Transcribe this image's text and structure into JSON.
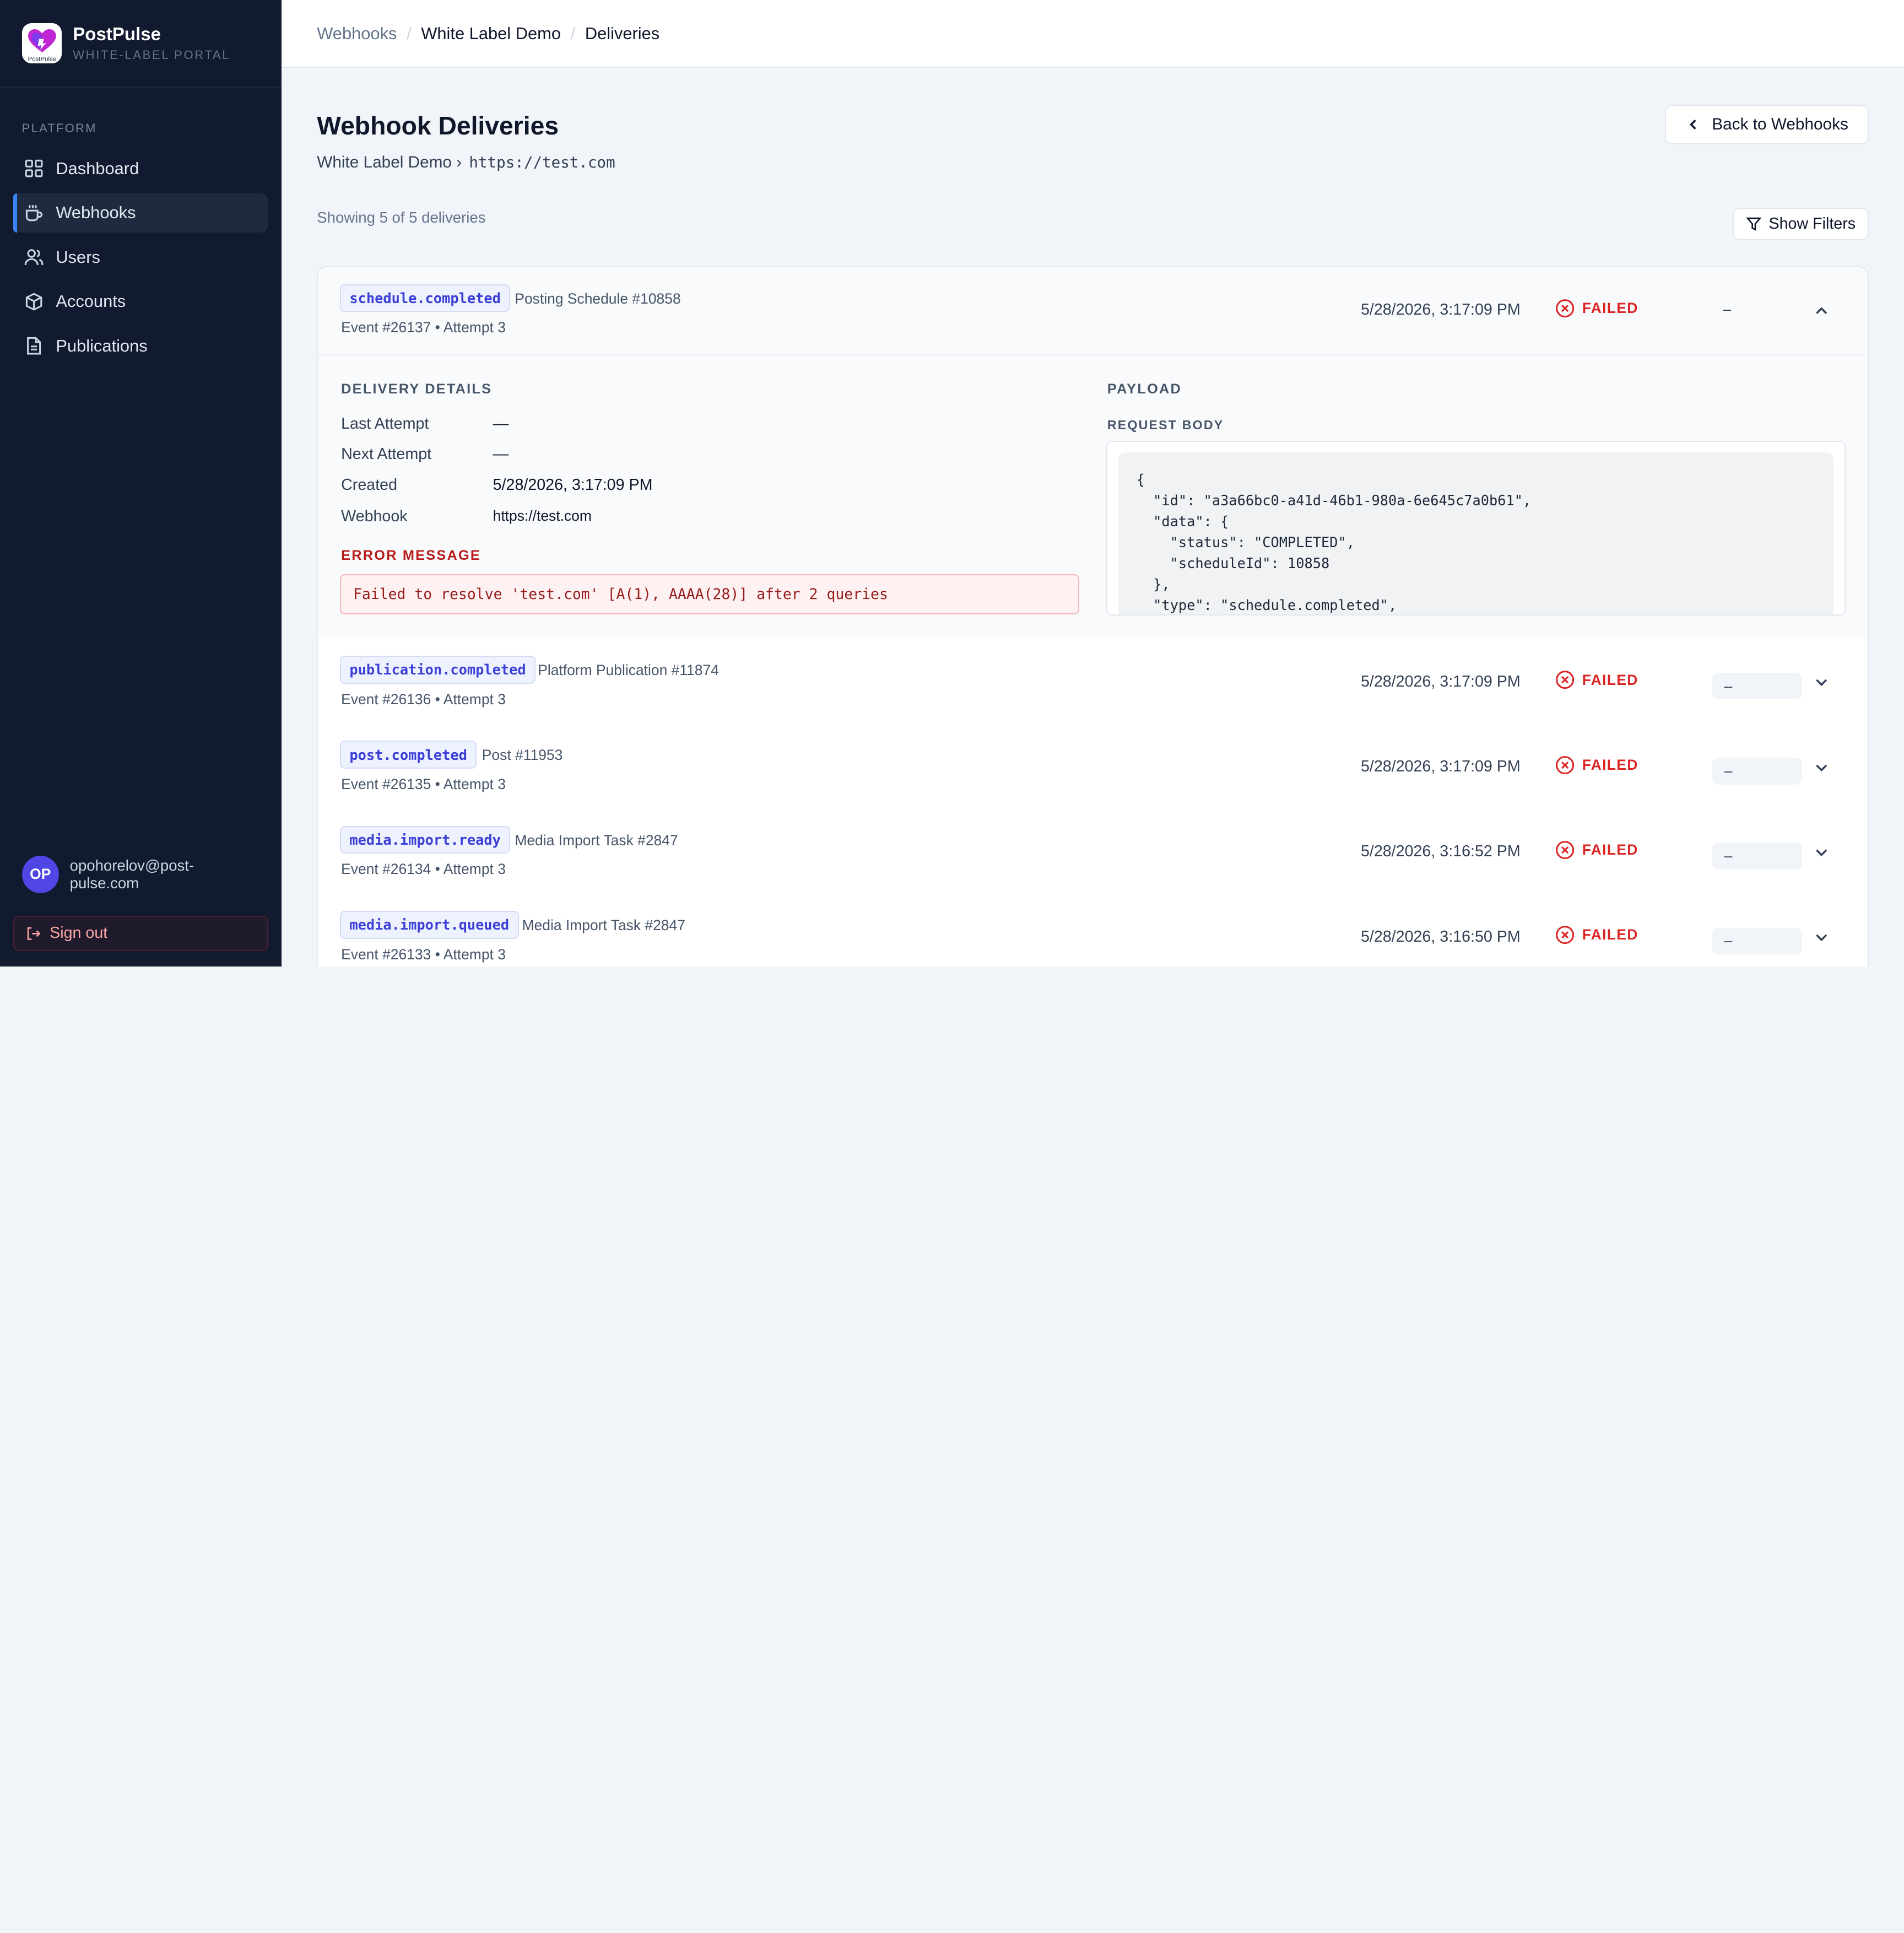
{
  "brand": {
    "name": "PostPulse",
    "subtitle": "WHITE-LABEL PORTAL",
    "logo_text": "PostPulse"
  },
  "sidebar": {
    "section_label": "PLATFORM",
    "items": [
      {
        "label": "Dashboard",
        "icon": "dashboard-grid-icon",
        "active": false
      },
      {
        "label": "Webhooks",
        "icon": "webhook-cup-icon",
        "active": true
      },
      {
        "label": "Users",
        "icon": "users-icon",
        "active": false
      },
      {
        "label": "Accounts",
        "icon": "box-icon",
        "active": false
      },
      {
        "label": "Publications",
        "icon": "document-icon",
        "active": false
      }
    ],
    "user": {
      "initials": "OP",
      "email": "opohorelov@post-pulse.com"
    },
    "signout_label": "Sign out"
  },
  "breadcrumb": {
    "item1": "Webhooks",
    "item2": "White Label Demo",
    "item3": "Deliveries"
  },
  "page": {
    "title": "Webhook Deliveries",
    "subtitle_name": "White Label Demo ›",
    "subtitle_url": "https://test.com",
    "back_label": "Back to Webhooks",
    "showing": "Showing 5 of 5 deliveries",
    "filters_label": "Show Filters"
  },
  "deliveries": [
    {
      "event": "schedule.completed",
      "source": "Posting Schedule #10858",
      "meta": "Event #26137 • Attempt 3",
      "time": "5/28/2026, 3:17:09 PM",
      "status": "FAILED",
      "code": "–"
    },
    {
      "event": "publication.completed",
      "source": "Platform Publication #11874",
      "meta": "Event #26136 • Attempt 3",
      "time": "5/28/2026, 3:17:09 PM",
      "status": "FAILED",
      "code": "–"
    },
    {
      "event": "post.completed",
      "source": "Post #11953",
      "meta": "Event #26135 • Attempt 3",
      "time": "5/28/2026, 3:17:09 PM",
      "status": "FAILED",
      "code": "–"
    },
    {
      "event": "media.import.ready",
      "source": "Media Import Task #2847",
      "meta": "Event #26134 • Attempt 3",
      "time": "5/28/2026, 3:16:52 PM",
      "status": "FAILED",
      "code": "–"
    },
    {
      "event": "media.import.queued",
      "source": "Media Import Task #2847",
      "meta": "Event #26133 • Attempt 3",
      "time": "5/28/2026, 3:16:50 PM",
      "status": "FAILED",
      "code": "–"
    }
  ],
  "details": {
    "heading": "DELIVERY DETAILS",
    "last_attempt_label": "Last Attempt",
    "last_attempt": "—",
    "next_attempt_label": "Next Attempt",
    "next_attempt": "—",
    "created_label": "Created",
    "created": "5/28/2026, 3:17:09 PM",
    "webhook_label": "Webhook",
    "webhook": "https://test.com",
    "error_heading": "ERROR MESSAGE",
    "error_message": "Failed to resolve 'test.com' [A(1), AAAA(28)] after 2 queries",
    "payload_heading": "PAYLOAD",
    "request_body_heading": "REQUEST BODY",
    "request_body": "{\n  \"id\": \"a3a66bc0-a41d-46b1-980a-6e645c7a0b61\",\n  \"data\": {\n    \"status\": \"COMPLETED\",\n    \"scheduleId\": 10858\n  },\n  \"type\": \"schedule.completed\","
  }
}
